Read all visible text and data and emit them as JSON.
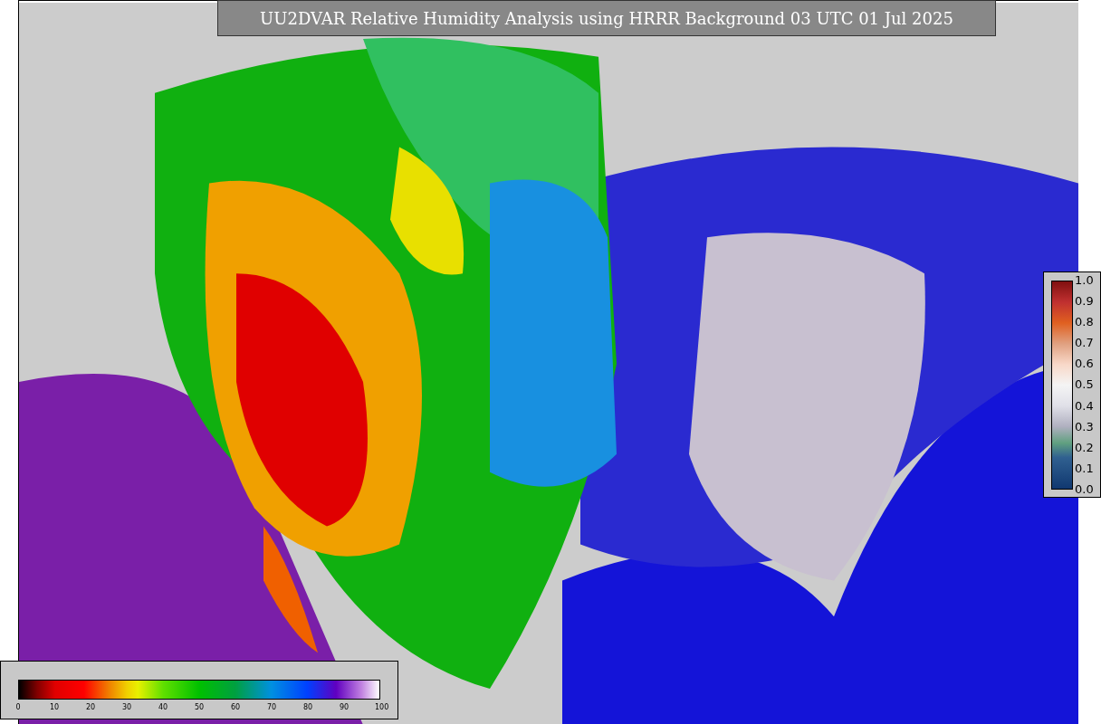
{
  "title": "UU2DVAR Relative Humidity Analysis using HRRR Background 03 UTC 01 Jul 2025",
  "fraction_colorbar": {
    "ticks": [
      "1.0",
      "0.9",
      "0.8",
      "0.7",
      "0.6",
      "0.5",
      "0.4",
      "0.3",
      "0.2",
      "0.1",
      "0.0"
    ]
  },
  "percent_colorbar": {
    "ticks": [
      "0",
      "10",
      "20",
      "30",
      "40",
      "50",
      "60",
      "70",
      "80",
      "90",
      "100"
    ]
  }
}
